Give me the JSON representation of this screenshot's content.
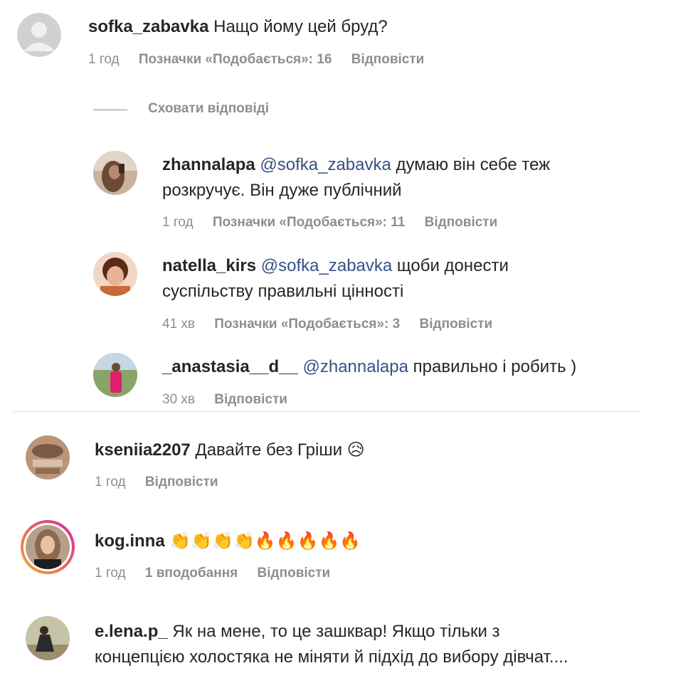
{
  "comments": [
    {
      "username": "sofka_zabavka",
      "text": "Нащо йому цей бруд?",
      "time": "1 год",
      "likes": "Позначки «Подобається»: 16",
      "reply": "Відповісти"
    }
  ],
  "hide_replies": "Сховати відповіді",
  "replies": [
    {
      "username": "zhannalapa",
      "mention": "@sofka_zabavka",
      "text_line1": "думаю він себе теж",
      "text_line2": "розкручує. Він дуже публічний",
      "time": "1 год",
      "likes": "Позначки «Подобається»: 11",
      "reply": "Відповісти"
    },
    {
      "username": "natella_kirs",
      "mention": "@sofka_zabavka",
      "text_line1": "щоби донести",
      "text_line2": "суспільству правильні цінності",
      "time": "41 хв",
      "likes": "Позначки «Подобається»: 3",
      "reply": "Відповісти"
    },
    {
      "username": "_anastasia__d__",
      "mention": "@zhannalapa",
      "text_line1": "правильно і робить )",
      "time": "30 хв",
      "reply": "Відповісти"
    }
  ],
  "more_comments": [
    {
      "username": "kseniia2207",
      "text": "Давайте без Гріши",
      "emoji": "😥",
      "time": "1 год",
      "reply": "Відповісти"
    },
    {
      "username": "kog.inna",
      "emoji": "👏👏👏👏🔥🔥🔥🔥🔥",
      "time": "1 год",
      "likes": "1 вподобання",
      "reply": "Відповісти"
    },
    {
      "username": "e.lena.p_",
      "text_line1": "Як на мене, то це зашквар! Якщо тільки з",
      "text_line2": "концепцією холостяка не міняти й підхід до вибору дівчат...."
    }
  ],
  "icons": {
    "default_avatar": "default-avatar-icon"
  },
  "colors": {
    "text": "#262626",
    "muted": "#8e8e8e",
    "mention": "#385185",
    "divider": "#dbdbdb",
    "story_ring_start": "#f9a825",
    "story_ring_end": "#d6249f"
  }
}
